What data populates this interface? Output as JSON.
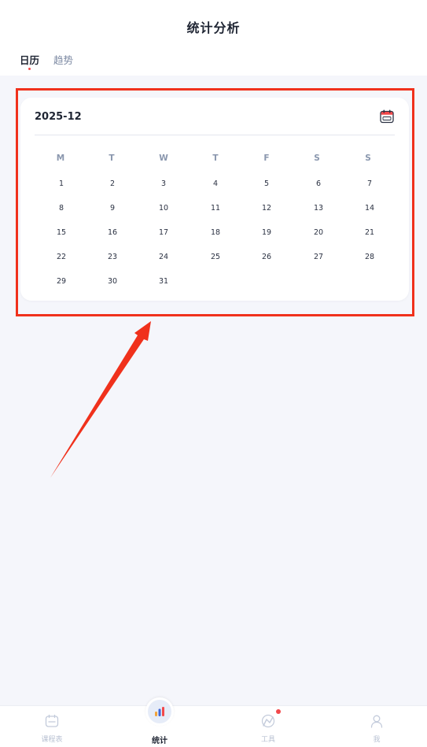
{
  "header": {
    "title": "统计分析"
  },
  "tabs": [
    {
      "label": "日历",
      "active": true
    },
    {
      "label": "趋势",
      "active": false
    }
  ],
  "calendar": {
    "month": "2025-12",
    "weekdays": [
      "M",
      "T",
      "W",
      "T",
      "F",
      "S",
      "S"
    ],
    "weeks": [
      [
        "1",
        "2",
        "3",
        "4",
        "5",
        "6",
        "7"
      ],
      [
        "8",
        "9",
        "10",
        "11",
        "12",
        "13",
        "14"
      ],
      [
        "15",
        "16",
        "17",
        "18",
        "19",
        "20",
        "21"
      ],
      [
        "22",
        "23",
        "24",
        "25",
        "26",
        "27",
        "28"
      ],
      [
        "29",
        "30",
        "31"
      ]
    ]
  },
  "bottom_nav": [
    {
      "label": "课程表",
      "icon": "calendar-icon",
      "active": false
    },
    {
      "label": "统计",
      "icon": "bar-chart-icon",
      "active": true
    },
    {
      "label": "工具",
      "icon": "tools-icon",
      "active": false,
      "badge_dot": true
    },
    {
      "label": "我",
      "icon": "user-icon",
      "active": false
    }
  ],
  "colors": {
    "accent": "#f2484b",
    "annotation": "#f0311c",
    "page_background": "#f5f6fb",
    "text_primary": "#1f2533",
    "text_muted": "#8a97ae"
  }
}
